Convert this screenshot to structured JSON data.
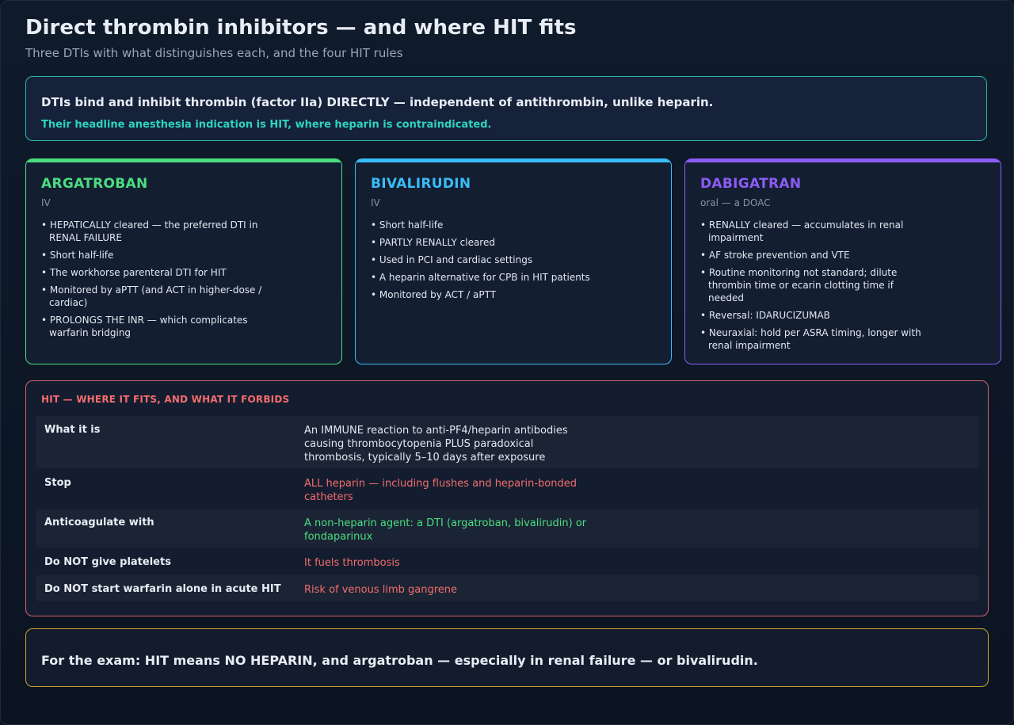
{
  "header": {
    "title": "Direct thrombin inhibitors — and where HIT fits",
    "subtitle": "Three DTIs with what distinguishes each, and the four HIT rules"
  },
  "callout": {
    "main": "DTIs bind and inhibit thrombin (factor IIa) DIRECTLY — independent of antithrombin, unlike heparin.",
    "sub": "Their headline anesthesia indication is HIT, where heparin is contraindicated."
  },
  "cards": [
    {
      "name": "ARGATROBAN",
      "route": "IV",
      "color": "#4ade80",
      "bullets": [
        "HEPATICALLY cleared — the preferred DTI in RENAL FAILURE",
        "Short half-life",
        "The workhorse parenteral DTI for HIT",
        "Monitored by aPTT (and ACT in higher-dose / cardiac)",
        "PROLONGS THE INR — which complicates warfarin bridging"
      ]
    },
    {
      "name": "BIVALIRUDIN",
      "route": "IV",
      "color": "#38bdf8",
      "bullets": [
        "Short half-life",
        "PARTLY RENALLY cleared",
        "Used in PCI and cardiac settings",
        "A heparin alternative for CPB in HIT patients",
        "Monitored by ACT / aPTT"
      ]
    },
    {
      "name": "DABIGATRAN",
      "route": "oral — a DOAC",
      "color": "#8b5cf6",
      "bullets": [
        "RENALLY cleared — accumulates in renal impairment",
        "AF stroke prevention and VTE",
        "Routine monitoring not standard; dilute thrombin time or ecarin clotting time if needed",
        "Reversal: IDARUCIZUMAB",
        "Neuraxial: hold per ASRA timing, longer with renal impairment"
      ]
    }
  ],
  "hit": {
    "heading": "HIT — WHERE IT FITS, AND WHAT IT FORBIDS",
    "rows": [
      {
        "label": "What it is",
        "value": "An IMMUNE reaction to anti-PF4/heparin antibodies causing thrombocytopenia PLUS paradoxical thrombosis, typically 5–10 days after exposure",
        "color": "#e2e8f0"
      },
      {
        "label": "Stop",
        "value": "ALL heparin — including flushes and heparin-bonded catheters",
        "color": "#f26d6d"
      },
      {
        "label": "Anticoagulate with",
        "value": "A non-heparin agent: a DTI (argatroban, bivalirudin) or fondaparinux",
        "color": "#4ade80"
      },
      {
        "label": "Do NOT give platelets",
        "value": "It fuels thrombosis",
        "color": "#f26d6d"
      },
      {
        "label": "Do NOT start warfarin alone in acute HIT",
        "value": "Risk of venous limb gangrene",
        "color": "#f26d6d"
      }
    ]
  },
  "footer": {
    "text": "For the exam: HIT means NO HEPARIN, and argatroban — especially in renal failure — or bivalirudin."
  }
}
